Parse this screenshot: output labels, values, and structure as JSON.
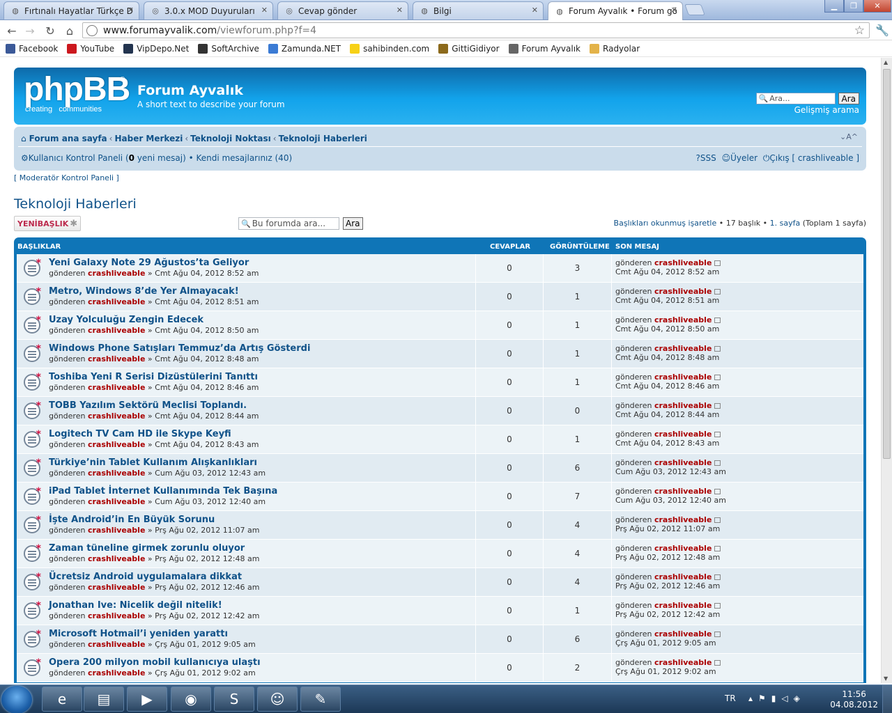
{
  "browser": {
    "tabs": [
      {
        "title": "Fırtınalı Hayatlar Türkçe Dubl",
        "icon": "globe-icon"
      },
      {
        "title": "3.0.x MOD Duyuruları",
        "icon": "phpbb-icon"
      },
      {
        "title": "Cevap gönder",
        "icon": "phpbb-icon"
      },
      {
        "title": "Bilgi",
        "icon": "globe-icon"
      },
      {
        "title": "Forum Ayvalık • Forum görünt",
        "icon": "globe-icon",
        "active": true
      }
    ],
    "url_host": "www.forumayvalik.com",
    "url_path": "/viewforum.php?f=4",
    "bookmarks": [
      {
        "label": "Facebook",
        "icon": "facebook-icon",
        "color": "#3b5998"
      },
      {
        "label": "YouTube",
        "icon": "youtube-icon",
        "color": "#cc181e"
      },
      {
        "label": "VipDepo.Net",
        "icon": "vipdepo-icon",
        "color": "#23344f"
      },
      {
        "label": "SoftArchive",
        "icon": "softarchive-icon",
        "color": "#333333"
      },
      {
        "label": "Zamunda.NET",
        "icon": "zamunda-icon",
        "color": "#3b7bd4"
      },
      {
        "label": "sahibinden.com",
        "icon": "sahibinden-icon",
        "color": "#f7d117"
      },
      {
        "label": "GittiGidiyor",
        "icon": "gittigidiyor-icon",
        "color": "#8c6a1c"
      },
      {
        "label": "Forum Ayvalık",
        "icon": "globe-icon",
        "color": "#666666"
      },
      {
        "label": "Radyolar",
        "icon": "folder-icon",
        "color": "#e3b34a"
      }
    ]
  },
  "header": {
    "logo_text": "phpBB",
    "logo_registered": "®",
    "logo_tag_1": "creating",
    "logo_tag_2": "communities",
    "site_title": "Forum Ayvalık",
    "site_description": "A short text to describe your forum",
    "search_placeholder": "Ara...",
    "search_button": "Ara",
    "advanced_search": "Gelişmiş arama"
  },
  "navbar": {
    "crumbs": [
      "Forum ana sayfa",
      "Haber Merkezi",
      "Teknoloji Noktası",
      "Teknoloji Haberleri"
    ],
    "font_size_control": "⌄A^",
    "ucp_link": "Kullanıcı Kontrol Paneli",
    "ucp_open": " (",
    "ucp_count": "0",
    "ucp_suffix": " yeni mesaj)",
    "own_posts": " • Kendi mesajlarınız (40)",
    "faq": "SSS",
    "members": "Üyeler",
    "logout": "Çıkış [ crashliveable ]"
  },
  "mcp_link": "[ Moderatör Kontrol Paneli ]",
  "forum_title": "Teknoloji Haberleri",
  "new_topic": "YENİBAŞLIK",
  "forum_search_placeholder": "Bu forumda ara...",
  "forum_search_button": "Ara",
  "pagination": {
    "mark_read": "Başlıkları okunmuş işaretle",
    "summary": " • 17 başlık • ",
    "page": "1. sayfa",
    "total": " (Toplam 1 sayfa)"
  },
  "table": {
    "headers": {
      "topics": "BAŞLIKLAR",
      "replies": "CEVAPLAR",
      "views": "GÖRÜNTÜLEME",
      "last_post": "SON MESAJ"
    },
    "by_prefix": "gönderen ",
    "sep": " » ",
    "rows": [
      {
        "title": "Yeni Galaxy Note 29 Ağustos’ta Geliyor",
        "author": "crashliveable",
        "date": "Cmt Ağu 04, 2012 8:52 am",
        "replies": "0",
        "views": "3"
      },
      {
        "title": "Metro, Windows 8’de Yer Almayacak!",
        "author": "crashliveable",
        "date": "Cmt Ağu 04, 2012 8:51 am",
        "replies": "0",
        "views": "1"
      },
      {
        "title": "Uzay Yolculuğu Zengin Edecek",
        "author": "crashliveable",
        "date": "Cmt Ağu 04, 2012 8:50 am",
        "replies": "0",
        "views": "1"
      },
      {
        "title": "Windows Phone Satışları Temmuz’da Artış Gösterdi",
        "author": "crashliveable",
        "date": "Cmt Ağu 04, 2012 8:48 am",
        "replies": "0",
        "views": "1"
      },
      {
        "title": "Toshiba Yeni R Serisi Dizüstülerini Tanıttı",
        "author": "crashliveable",
        "date": "Cmt Ağu 04, 2012 8:46 am",
        "replies": "0",
        "views": "1"
      },
      {
        "title": "TOBB Yazılım Sektörü Meclisi Toplandı.",
        "author": "crashliveable",
        "date": "Cmt Ağu 04, 2012 8:44 am",
        "replies": "0",
        "views": "0"
      },
      {
        "title": "Logitech TV Cam HD ile Skype Keyfi",
        "author": "crashliveable",
        "date": "Cmt Ağu 04, 2012 8:43 am",
        "replies": "0",
        "views": "1"
      },
      {
        "title": "Türkiye’nin Tablet Kullanım Alışkanlıkları",
        "author": "crashliveable",
        "date": "Cum Ağu 03, 2012 12:43 am",
        "replies": "0",
        "views": "6"
      },
      {
        "title": "iPad Tablet İnternet Kullanımında Tek Başına",
        "author": "crashliveable",
        "date": "Cum Ağu 03, 2012 12:40 am",
        "replies": "0",
        "views": "7"
      },
      {
        "title": "İşte Android’in En Büyük Sorunu",
        "author": "crashliveable",
        "date": "Prş Ağu 02, 2012 11:07 am",
        "replies": "0",
        "views": "4"
      },
      {
        "title": "Zaman tüneline girmek zorunlu oluyor",
        "author": "crashliveable",
        "date": "Prş Ağu 02, 2012 12:48 am",
        "replies": "0",
        "views": "4"
      },
      {
        "title": "Ücretsiz Android uygulamalara dikkat",
        "author": "crashliveable",
        "date": "Prş Ağu 02, 2012 12:46 am",
        "replies": "0",
        "views": "4"
      },
      {
        "title": "Jonathan Ive: Nicelik değil nitelik!",
        "author": "crashliveable",
        "date": "Prş Ağu 02, 2012 12:42 am",
        "replies": "0",
        "views": "1"
      },
      {
        "title": "Microsoft Hotmail’i yeniden yarattı",
        "author": "crashliveable",
        "date": "Çrş Ağu 01, 2012 9:05 am",
        "replies": "0",
        "views": "6"
      },
      {
        "title": "Opera 200 milyon mobil kullanıcıya ulaştı",
        "author": "crashliveable",
        "date": "Çrş Ağu 01, 2012 9:02 am",
        "replies": "0",
        "views": "2"
      }
    ]
  },
  "taskbar": {
    "apps": [
      {
        "name": "ie-icon",
        "glyph": "e"
      },
      {
        "name": "explorer-icon",
        "glyph": "▤"
      },
      {
        "name": "media-player-icon",
        "glyph": "▶"
      },
      {
        "name": "chrome-icon",
        "glyph": "◉"
      },
      {
        "name": "skype-icon",
        "glyph": "S"
      },
      {
        "name": "messenger-icon",
        "glyph": "☺"
      },
      {
        "name": "paint-icon",
        "glyph": "✎"
      }
    ],
    "lang": "TR",
    "time": "11:56",
    "date": "04.08.2012"
  }
}
